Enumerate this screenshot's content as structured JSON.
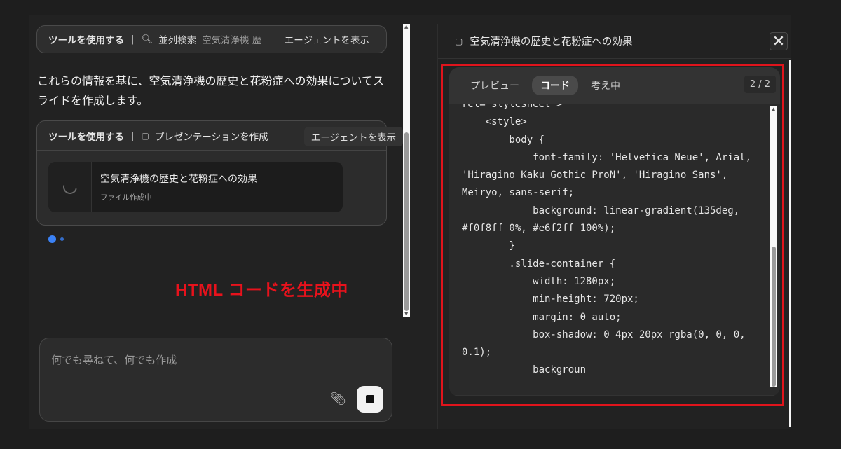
{
  "chat": {
    "search_tool": {
      "label": "ツールを使用する",
      "separator": "|",
      "icon": "search-icon",
      "name": "並列検索",
      "query": "空気清浄機 歴",
      "agent_button": "エージェントを表示"
    },
    "message": "これらの情報を基に、空気清浄機の歴史と花粉症への効果についてスライドを作成します。",
    "presentation_tool": {
      "label": "ツールを使用する",
      "separator": "|",
      "icon": "presentation-icon",
      "name": "プレゼンテーションを作成",
      "agent_button": "エージェントを表示",
      "file_title": "空気清浄機の歴史と花粉症への効果",
      "file_status": "ファイル作成中"
    },
    "overlay_label": "HTML コードを生成中",
    "composer": {
      "placeholder": "何でも尋ねて、何でも作成",
      "attach_icon": "paperclip-icon",
      "stop_icon": "stop-icon"
    }
  },
  "panel": {
    "title": "空気清浄機の歴史と花粉症への効果",
    "close_icon": "close-icon",
    "tabs": [
      {
        "label": "プレビュー",
        "active": false
      },
      {
        "label": "コード",
        "active": true
      },
      {
        "label": "考え中",
        "active": false
      }
    ],
    "page_indicator": "2 / 2",
    "code_lines": [
      "rel=\"stylesheet\">",
      "    <style>",
      "        body {",
      "            font-family: 'Helvetica Neue', Arial,",
      "'Hiragino Kaku Gothic ProN', 'Hiragino Sans',",
      "Meiryo, sans-serif;",
      "            background: linear-gradient(135deg,",
      "#f0f8ff 0%, #e6f2ff 100%);",
      "        }",
      "        .slide-container {",
      "            width: 1280px;",
      "            min-height: 720px;",
      "            margin: 0 auto;",
      "            box-shadow: 0 4px 20px rgba(0, 0, 0,",
      "0.1);",
      "            backgroun"
    ]
  },
  "colors": {
    "background": "#222222",
    "accent_blue": "#3b82f6",
    "highlight_red": "#e0141c"
  }
}
